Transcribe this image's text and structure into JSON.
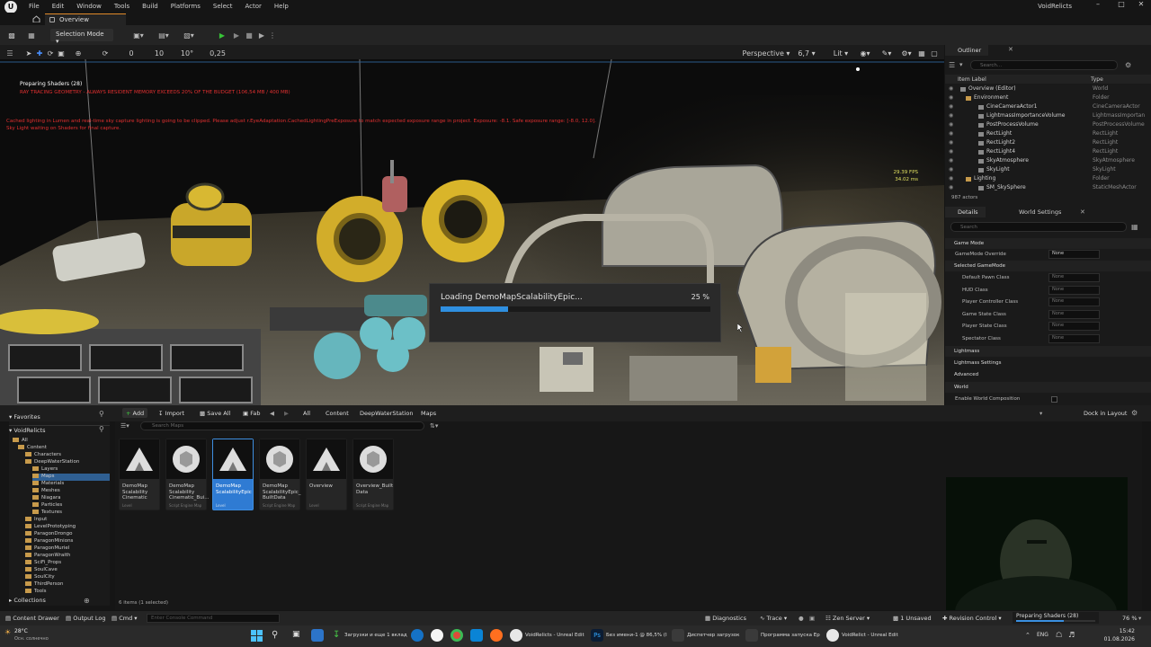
{
  "menubar": {
    "logo": "U",
    "items": [
      "File",
      "Edit",
      "Window",
      "Tools",
      "Build",
      "Platforms",
      "Select",
      "Actor",
      "Help"
    ],
    "project": "VoidRelicts",
    "window_controls": [
      "–",
      "□",
      "✕"
    ]
  },
  "tabs": {
    "home_icon": "home-icon",
    "active": "Overview"
  },
  "toolbar": {
    "selection_mode": "Selection Mode",
    "play_icon": "▶"
  },
  "viewport_toolbar": {
    "grid_snap": "10",
    "rot_snap": "10°",
    "scale_snap": "0,25",
    "camera_speed_left": "0",
    "perspective": "Perspective",
    "fov": "6,7",
    "view_mode": "Lit"
  },
  "viewport": {
    "status_title": "Preparing Shaders (28)",
    "warning_1": "RAY TRACING GEOMETRY - ALWAYS RESIDENT MEMORY EXCEEDS 20% OF THE BUDGET (106,54 MB / 400 MB)",
    "warning_2": "Cached lighting in Lumen and real-time sky capture lighting is going to be clipped. Please adjust r.EyeAdaptation.CachedLightingPreExposure to match expected exposure range in project. Exposure: -8.1. Safe exposure range: [-8.0, 12.0].",
    "warning_3": "Sky Light waiting on Shaders for final capture.",
    "fps": "29.39 FPS",
    "ms": "34.02 ms"
  },
  "loading": {
    "label": "Loading DemoMapScalabilityEpic...",
    "percent": "25 %",
    "progress": 0.25
  },
  "outliner": {
    "tab": "Outliner",
    "search_placeholder": "Search...",
    "col_label": "Item Label",
    "col_type": "Type",
    "rows": [
      {
        "label": "Overview (Editor)",
        "type": "World"
      },
      {
        "label": "Environment",
        "type": "Folder"
      },
      {
        "label": "CineCameraActor1",
        "type": "CineCameraActor"
      },
      {
        "label": "LightmassImportanceVolume",
        "type": "LightmassImportan"
      },
      {
        "label": "PostProcessVolume",
        "type": "PostProcessVolume"
      },
      {
        "label": "RectLight",
        "type": "RectLight"
      },
      {
        "label": "RectLight2",
        "type": "RectLight"
      },
      {
        "label": "RectLight4",
        "type": "RectLight"
      },
      {
        "label": "SkyAtmosphere",
        "type": "SkyAtmosphere"
      },
      {
        "label": "SkyLight",
        "type": "SkyLight"
      },
      {
        "label": "Lighting",
        "type": "Folder"
      },
      {
        "label": "SM_SkySphere",
        "type": "StaticMeshActor"
      }
    ],
    "count": "987 actors"
  },
  "details": {
    "tab1": "Details",
    "tab2": "World Settings",
    "search_placeholder": "Search",
    "sections": [
      {
        "title": "Game Mode"
      },
      {
        "title": "Selected GameMode"
      },
      {
        "title": "Lightmass"
      },
      {
        "title": "Lightmass Settings"
      },
      {
        "title": "Advanced"
      },
      {
        "title": "World"
      }
    ],
    "rows": [
      {
        "label": "GameMode Override",
        "value": "None"
      },
      {
        "label": "Default Pawn Class",
        "value": "None"
      },
      {
        "label": "HUD Class",
        "value": "None"
      },
      {
        "label": "Player Controller Class",
        "value": "None"
      },
      {
        "label": "Game State Class",
        "value": "None"
      },
      {
        "label": "Player State Class",
        "value": "None"
      },
      {
        "label": "Spectator Class",
        "value": "None"
      },
      {
        "label": "Enable World Composition",
        "value": ""
      }
    ]
  },
  "content_browser": {
    "add": "Add",
    "import": "Import",
    "save_all": "Save All",
    "fab": "Fab",
    "crumbs": [
      "All",
      "Content",
      "DeepWaterStation",
      "Maps"
    ],
    "dock": "Dock in Layout",
    "search_placeholder": "Search Maps",
    "favorites": "Favorites",
    "project": "VoidRelicts",
    "collections": "Collections",
    "tree": [
      "All",
      "Content",
      "Characters",
      "DeepWaterStation",
      "Layers",
      "Maps",
      "Materials",
      "Meshes",
      "Niagara",
      "Particles",
      "Textures",
      "Input",
      "LevelPrototyping",
      "ParagonDrongo",
      "ParagonMinions",
      "ParagonMuriel",
      "ParagonWraith",
      "SciFi_Props",
      "SoulCave",
      "SoulCity",
      "ThirdPerson",
      "Tools"
    ],
    "assets": [
      {
        "name": "DemoMap Scalability Cinematic",
        "sub": "Level"
      },
      {
        "name": "DemoMap Scalability Cinematic_Bui...",
        "sub": "Script Engine Map"
      },
      {
        "name": "DemoMap ScalabilityEpic",
        "sub": "Level"
      },
      {
        "name": "DemoMap ScalabilityEpic_ BuiltData",
        "sub": "Script Engine Map"
      },
      {
        "name": "Overview",
        "sub": "Level"
      },
      {
        "name": "Overview_Built Data",
        "sub": "Script Engine Map"
      }
    ],
    "count": "6 items (1 selected)"
  },
  "statusbar": {
    "drawer": "Content Drawer",
    "output": "Output Log",
    "cmd": "Cmd",
    "console_placeholder": "Enter Console Command",
    "diagnostics": "Diagnostics",
    "trace": "Trace",
    "zen": "Zen Server",
    "unsaved": "1 Unsaved",
    "revision": "Revision Control",
    "shaders": "Preparing Shaders (28)",
    "shader_progress": 0.6,
    "pct": "76 %"
  },
  "taskbar": {
    "weather_temp": "28°C",
    "weather_desc": "Осн. солнечно",
    "downloads": "Загрузки и еще 1 вклад",
    "unreal": "VoidRelicts - Unreal Edit",
    "ps": "Без имени-1 @ 86,5% (I",
    "dispatcher": "Диспетчер загрузок",
    "launcher": "Программа запуска Ep",
    "unreal2": "VoidRelict - Unreal Edit",
    "lang": "ENG",
    "time": "15:42",
    "date": "01.08.2026"
  }
}
